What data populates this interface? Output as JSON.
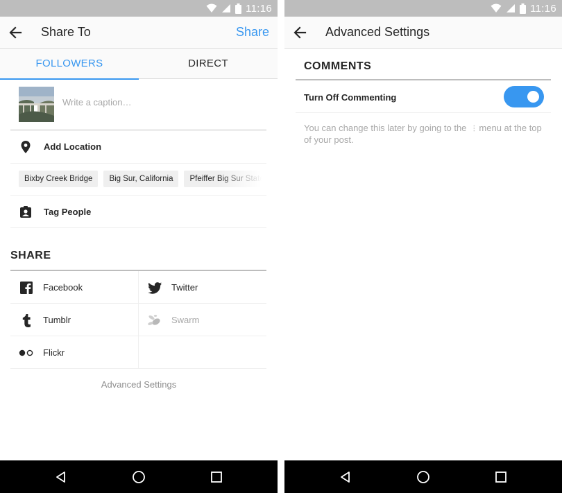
{
  "status_bar": {
    "time": "11:16",
    "icons": [
      "wifi-icon",
      "signal-icon",
      "battery-icon"
    ]
  },
  "left_screen": {
    "header": {
      "title": "Share To",
      "action": "Share"
    },
    "tabs": [
      {
        "label": "FOLLOWERS",
        "active": true
      },
      {
        "label": "DIRECT",
        "active": false
      }
    ],
    "caption": {
      "placeholder": "Write a caption…",
      "value": ""
    },
    "add_location": {
      "label": "Add Location",
      "icon": "location-pin-icon"
    },
    "location_suggestions": [
      "Bixby Creek Bridge",
      "Big Sur, California",
      "Pfeiffer Big Sur State Park"
    ],
    "tag_people": {
      "label": "Tag People",
      "icon": "tag-person-icon"
    },
    "share_section": {
      "heading": "SHARE",
      "services": [
        {
          "label": "Facebook",
          "icon": "facebook-icon",
          "enabled": true
        },
        {
          "label": "Twitter",
          "icon": "twitter-icon",
          "enabled": true
        },
        {
          "label": "Tumblr",
          "icon": "tumblr-icon",
          "enabled": true
        },
        {
          "label": "Swarm",
          "icon": "swarm-icon",
          "enabled": false
        },
        {
          "label": "Flickr",
          "icon": "flickr-icon",
          "enabled": true
        }
      ]
    },
    "advanced_link": "Advanced Settings"
  },
  "right_screen": {
    "header": {
      "title": "Advanced Settings"
    },
    "comments_section": {
      "heading": "COMMENTS",
      "toggle_label": "Turn Off Commenting",
      "toggle_on": true,
      "help_text_before": "You can change this later by going to the",
      "help_icon": "more-vertical-icon",
      "help_text_after": "menu at the top of your post."
    }
  },
  "nav_bar": {
    "buttons": [
      "back-triangle-icon",
      "home-circle-icon",
      "recents-square-icon"
    ]
  },
  "colors": {
    "accent": "#3897f0",
    "status_bar": "#bdbdbd",
    "nav_bar": "#000000",
    "text": "#262626",
    "muted": "#a8a8a8"
  }
}
